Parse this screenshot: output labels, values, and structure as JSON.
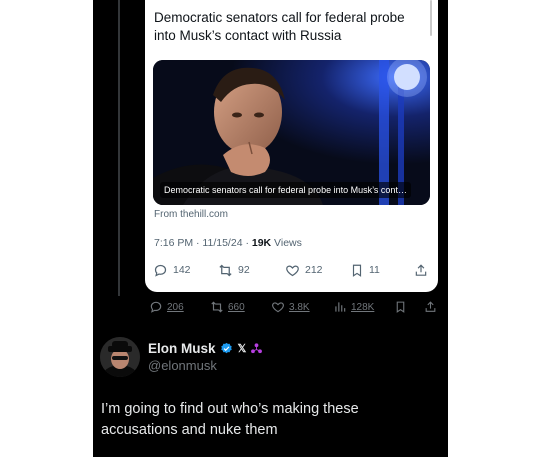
{
  "quote": {
    "text": "Democratic senators call for federal probe into Musk’s contact with Russia",
    "link_caption": "Democratic senators call for federal probe into Musk’s cont…",
    "link_domain": "From thehill.com",
    "time": "7:16 PM · 11/15/24 · ",
    "views_count": "19K",
    "views_label": " Views",
    "actions": {
      "replies": "142",
      "reposts": "92",
      "likes": "212",
      "bookmarks": "11"
    }
  },
  "outer_actions": {
    "replies": "206",
    "reposts": "660",
    "likes": "3.8K",
    "views": "128K"
  },
  "post": {
    "author_name": "Elon Musk",
    "x_glyph": "𝕏",
    "handle": "@elonmusk",
    "text": "I’m going to find out who’s making these accusations and nuke them"
  },
  "icons": {
    "reply": "reply-icon",
    "repost": "repost-icon",
    "like": "heart-icon",
    "bookmark": "bookmark-icon",
    "share": "share-icon",
    "views": "views-icon",
    "verified": "verified-badge-icon",
    "affiliate": "affiliate-icon"
  },
  "colors": {
    "verified": "#1d9bf0",
    "affiliate": "#b63fe0",
    "background": "#000000",
    "card": "#ffffff"
  }
}
